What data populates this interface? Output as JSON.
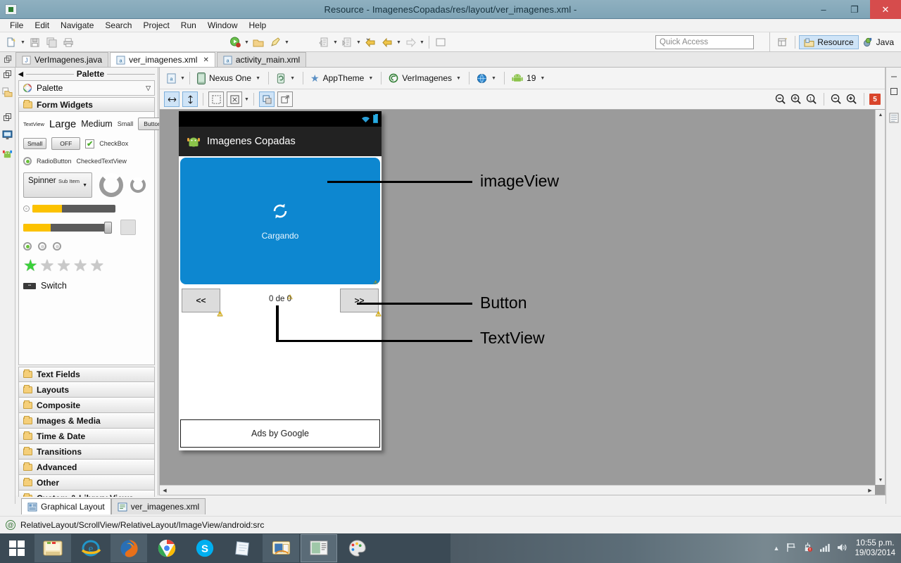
{
  "window": {
    "title": "Resource - ImagenesCopadas/res/layout/ver_imagenes.xml -",
    "app_icon": "eclipse-icon",
    "minimize": "–",
    "maximize": "❐",
    "close": "✕"
  },
  "menubar": {
    "items": [
      "File",
      "Edit",
      "Navigate",
      "Search",
      "Project",
      "Run",
      "Window",
      "Help"
    ]
  },
  "toolbar": {
    "left_icons": [
      "new-file-icon",
      "save-icon",
      "save-all-icon",
      "print-icon"
    ],
    "mid_icons": [
      "run-icon",
      "open-type-icon",
      "debug-icon"
    ],
    "nav_icons": [
      "previous-annotation-icon",
      "next-annotation-icon",
      "back-icon",
      "forward-icon",
      "new-window-icon"
    ],
    "quick_access_placeholder": "Quick Access",
    "open_perspective_icon": "open-perspective-icon",
    "perspectives": [
      {
        "label": "Resource",
        "icon": "resource-perspective-icon",
        "active": true
      },
      {
        "label": "Java",
        "icon": "java-perspective-icon",
        "active": false
      }
    ]
  },
  "editor_tabs": [
    {
      "label": "VerImagenes.java",
      "icon": "java-file-icon",
      "active": false,
      "closable": false
    },
    {
      "label": "ver_imagenes.xml",
      "icon": "xml-layout-icon",
      "active": true,
      "closable": true
    },
    {
      "label": "activity_main.xml",
      "icon": "xml-layout-icon",
      "active": false,
      "closable": false
    }
  ],
  "rail_left": [
    "restore-icon",
    "project-explorer-icon"
  ],
  "rail_left_lower": [
    "restore-icon",
    "outline-icon",
    "android-icon"
  ],
  "rail_right": [
    "minimize-icon",
    "maximize-icon",
    "properties-icon"
  ],
  "palette": {
    "header": "Palette",
    "collapse_icon": "collapse-left-icon",
    "selector_label": "Palette",
    "selector_icon": "palette-icon",
    "selector_caret": "▽",
    "group": {
      "label": "Form Widgets",
      "icon": "folder-icon"
    },
    "widgets": {
      "textview_tiny": "TextView",
      "textview_large": "Large",
      "textview_medium": "Medium",
      "textview_small": "Small",
      "button": "Button",
      "small_button": "Small",
      "toggle_off": "OFF",
      "checkbox": "CheckBox",
      "radiobutton": "RadioButton",
      "checkedtextview": "CheckedTextView",
      "spinner_main": "Spinner",
      "spinner_sub": "Sub Item",
      "switch": "Switch"
    },
    "categories": [
      "Text Fields",
      "Layouts",
      "Composite",
      "Images & Media",
      "Time & Date",
      "Transitions",
      "Advanced",
      "Other",
      "Custom & Library Views"
    ]
  },
  "editor_toolbar": {
    "config_icon": "layout-config-icon",
    "device": {
      "label": "Nexus One",
      "icon": "device-icon"
    },
    "orientation_icon": "orientation-portrait-icon",
    "theme": {
      "label": "AppTheme",
      "icon": "theme-star-icon"
    },
    "activity": {
      "label": "VerImagenes",
      "icon": "activity-icon"
    },
    "locale_icon": "locale-globe-icon",
    "api_level": {
      "label": "19",
      "icon": "android-icon"
    },
    "row2_buttons": [
      "fit-width-icon",
      "fit-height-icon",
      "select-all-icon",
      "distribute-icon",
      "outline-mode-icon",
      "include-in-icon"
    ],
    "zoom_buttons": [
      "zoom-out-real-icon",
      "zoom-fit-icon",
      "zoom-100-icon",
      "zoom-minus-icon",
      "zoom-plus-icon"
    ],
    "lint_badge": "5",
    "lint_badge_color": "#d9452b"
  },
  "preview": {
    "status_icons": [
      "wifi-icon",
      "battery-icon"
    ],
    "action_bar": {
      "title": "Imagenes Copadas",
      "icon": "android-app-icon"
    },
    "image_view": {
      "loading_icon": "refresh-icon",
      "loading_text": "Cargando",
      "color": "#0d87d0"
    },
    "prev_button": "<<",
    "next_button": ">>",
    "counter": "0 de 0",
    "ads_label": "Ads by Google",
    "warning_icon": "warning-icon"
  },
  "annotations": [
    {
      "label": "imageView"
    },
    {
      "label": "Button"
    },
    {
      "label": "TextView"
    }
  ],
  "bottom_tabs": [
    {
      "label": "Graphical Layout",
      "icon": "graphical-layout-icon",
      "active": true
    },
    {
      "label": "ver_imagenes.xml",
      "icon": "xml-source-icon",
      "active": false
    }
  ],
  "statusbar": {
    "icon": "at-sign-icon",
    "path": "RelativeLayout/ScrollView/RelativeLayout/ImageView/android:src"
  },
  "taskbar": {
    "start_icon": "windows-start-icon",
    "apps": [
      {
        "name": "file-explorer-icon",
        "state": "pinned"
      },
      {
        "name": "internet-explorer-icon",
        "state": "normal"
      },
      {
        "name": "firefox-icon",
        "state": "pinned"
      },
      {
        "name": "chrome-icon",
        "state": "normal"
      },
      {
        "name": "skype-icon",
        "state": "normal"
      },
      {
        "name": "notepad-icon",
        "state": "normal"
      },
      {
        "name": "media-player-icon",
        "state": "pinned"
      },
      {
        "name": "eclipse-icon",
        "state": "pressed"
      },
      {
        "name": "paint-icon",
        "state": "normal"
      }
    ],
    "tray_icons": [
      "show-hidden-icon",
      "flag-icon",
      "action-center-icon",
      "network-icon",
      "volume-icon"
    ],
    "clock_time": "10:55 p.m.",
    "clock_date": "19/03/2014"
  }
}
